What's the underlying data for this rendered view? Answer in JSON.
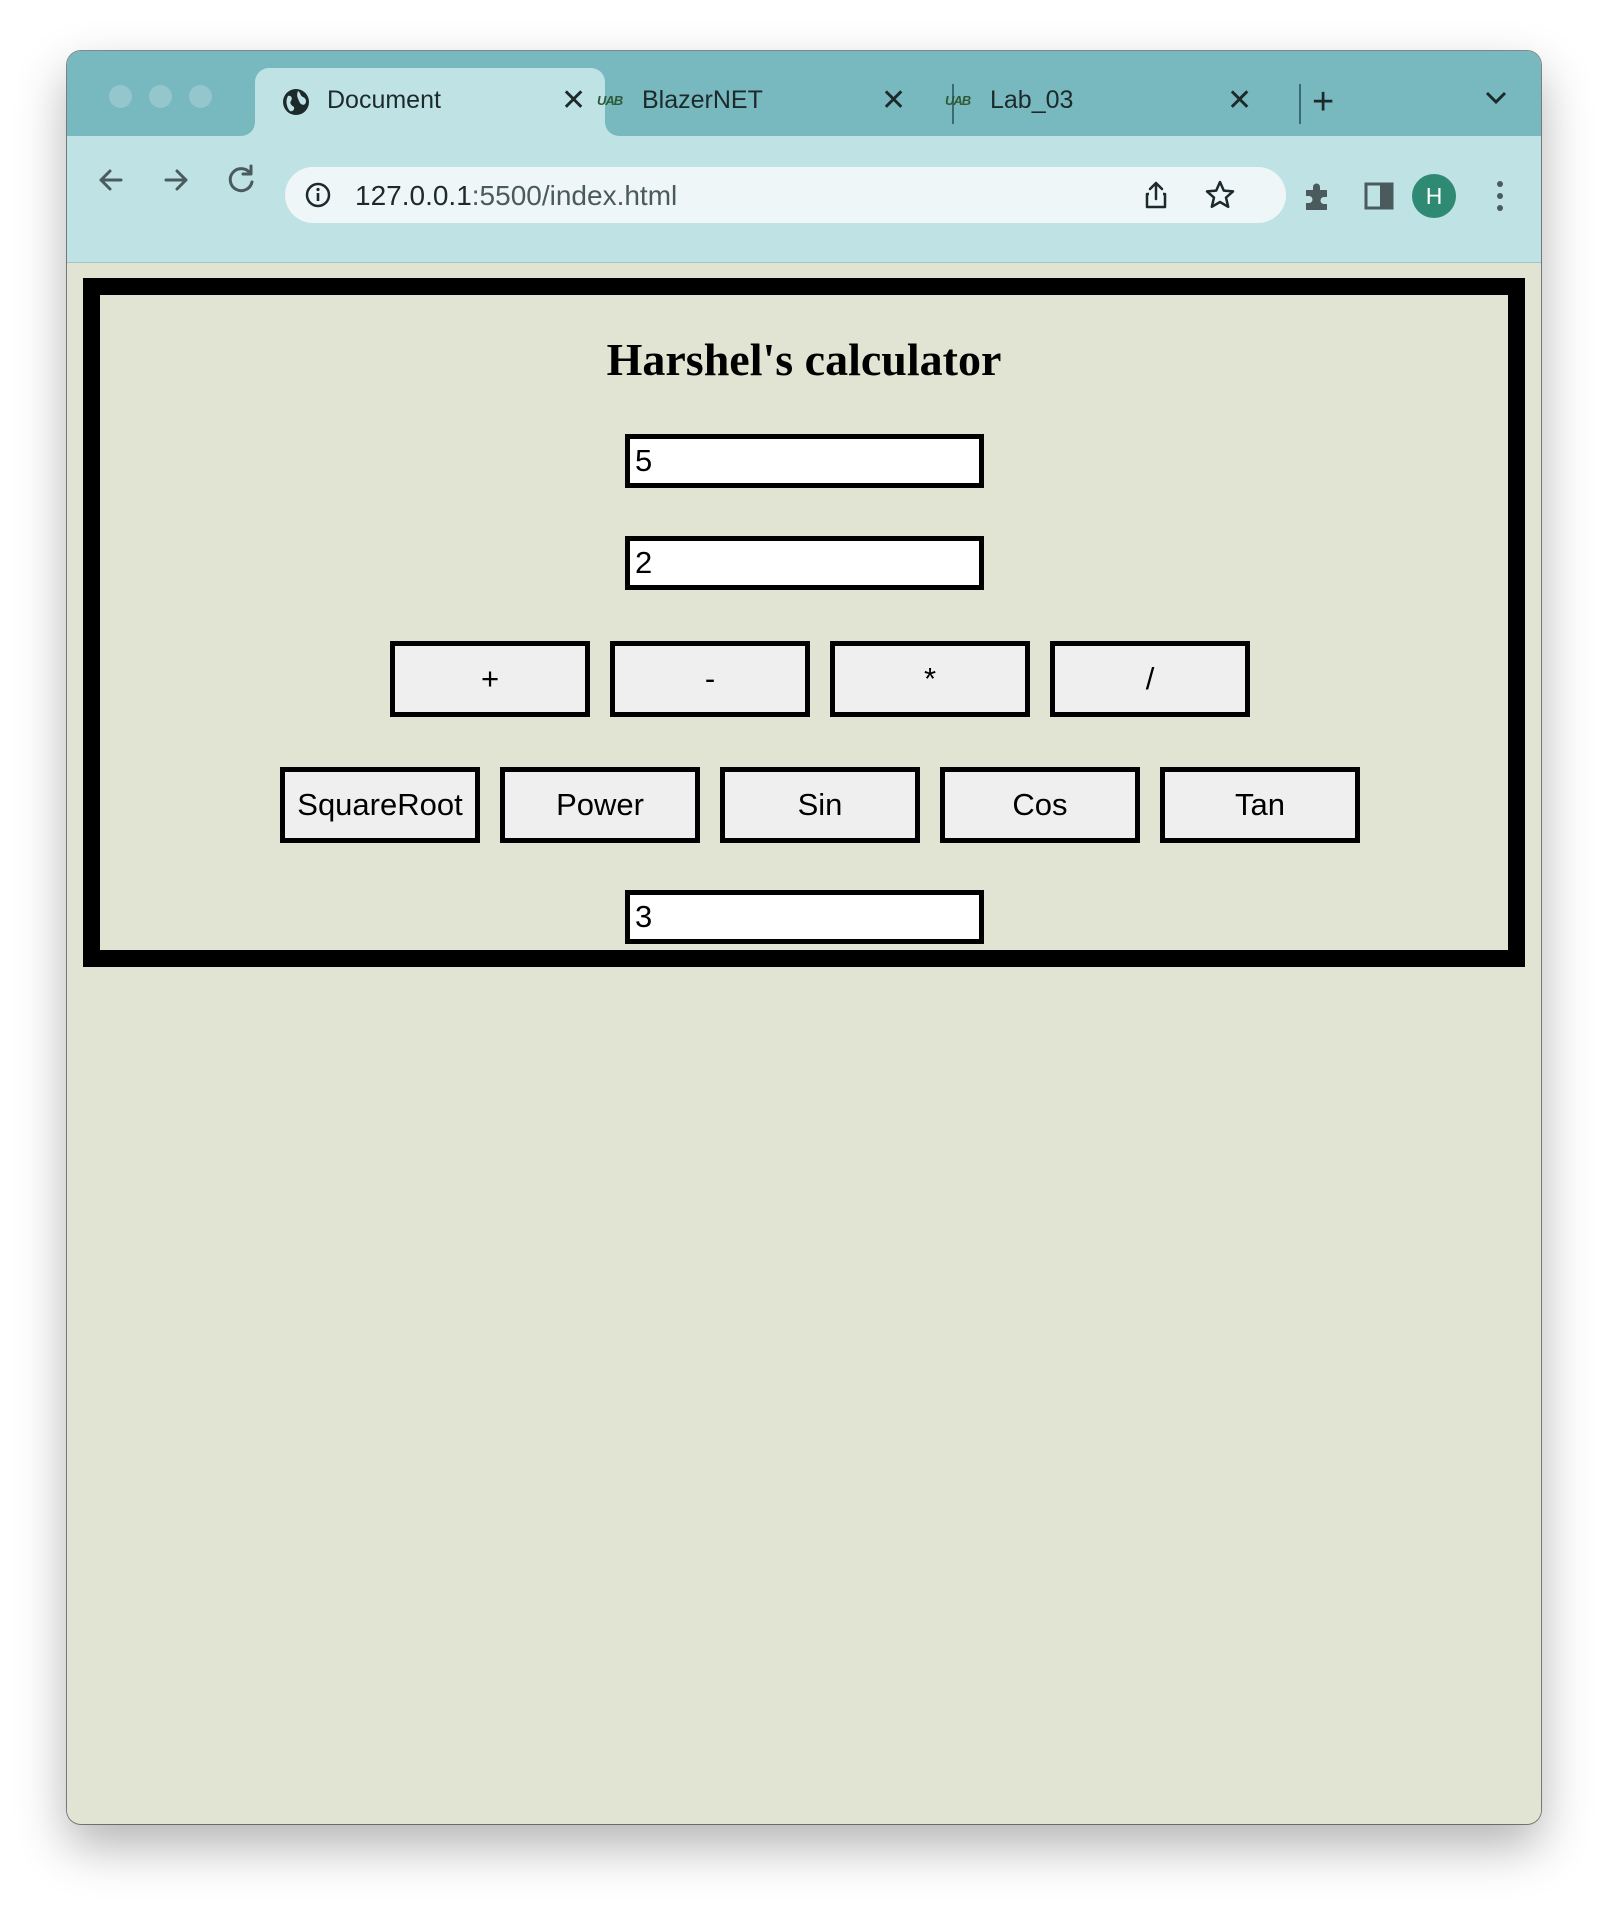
{
  "browser": {
    "tabs": [
      {
        "label": "Document",
        "favicon": "globe-icon",
        "active": true
      },
      {
        "label": "BlazerNET",
        "favicon": "UAB",
        "active": false
      },
      {
        "label": "Lab_03",
        "favicon": "UAB",
        "active": false
      }
    ],
    "address": {
      "host": "127.0.0.1",
      "path": ":5500/index.html"
    },
    "profile_initial": "H",
    "colors": {
      "tabstrip": "#78b8bf",
      "toolbar": "#bfe2e5",
      "page_background": "#e1e4d3",
      "avatar": "#2f8a73"
    }
  },
  "calculator": {
    "title": "Harshel's calculator",
    "input1": "5",
    "input2": "2",
    "result": "3",
    "operators": [
      "+",
      "-",
      "*",
      "/"
    ],
    "functions": [
      "SquareRoot",
      "Power",
      "Sin",
      "Cos",
      "Tan"
    ]
  }
}
